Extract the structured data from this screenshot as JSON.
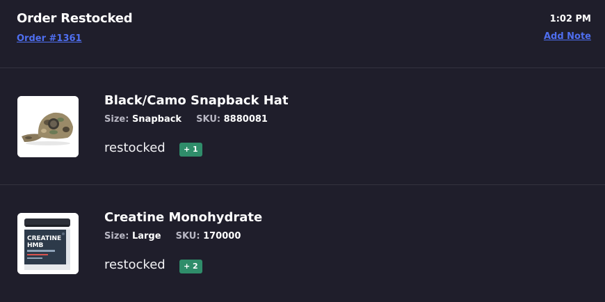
{
  "header": {
    "title": "Order Restocked",
    "order_link": "Order #1361",
    "time": "1:02 PM",
    "add_note": "Add Note"
  },
  "items": [
    {
      "name": "Black/Camo Snapback Hat",
      "size_label": "Size:",
      "size_value": "Snapback",
      "sku_label": "SKU:",
      "sku_value": "8880081",
      "status": "restocked",
      "badge": "+ 1",
      "image": "camo-snapback-hat-photo"
    },
    {
      "name": "Creatine Monohydrate",
      "size_label": "Size:",
      "size_value": "Large",
      "sku_label": "SKU:",
      "sku_value": "170000",
      "status": "restocked",
      "badge": "+ 2",
      "image": "creatine-tub-photo",
      "image_text": [
        "CREATINE",
        "HMB"
      ]
    }
  ],
  "colors": {
    "background": "#1f1e2b",
    "link": "#4f6ff0",
    "badge": "#2f8d6a",
    "divider": "#34333f"
  }
}
